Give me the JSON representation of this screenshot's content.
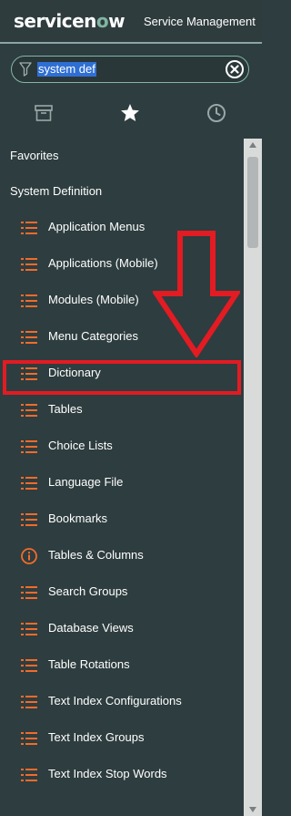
{
  "header": {
    "logo_prefix": "servicen",
    "logo_o": "o",
    "logo_suffix": "w",
    "subtitle": "Service Management"
  },
  "search": {
    "value": "system def",
    "filter_icon": "filter-icon",
    "clear_icon": "clear-circle-x-icon"
  },
  "tabs": [
    {
      "icon": "archive-box-icon",
      "name": "All applications"
    },
    {
      "icon": "star-icon",
      "name": "Favorites"
    },
    {
      "icon": "clock-icon",
      "name": "History"
    }
  ],
  "sections": [
    {
      "label": "Favorites"
    },
    {
      "label": "System Definition"
    }
  ],
  "items": [
    {
      "label": "Application Menus",
      "icon": "list-icon"
    },
    {
      "label": "Applications (Mobile)",
      "icon": "list-icon"
    },
    {
      "label": "Modules (Mobile)",
      "icon": "list-icon"
    },
    {
      "label": "Menu Categories",
      "icon": "list-icon"
    },
    {
      "label": "Dictionary",
      "icon": "list-icon"
    },
    {
      "label": "Tables",
      "icon": "list-icon"
    },
    {
      "label": "Choice Lists",
      "icon": "list-icon"
    },
    {
      "label": "Language File",
      "icon": "list-icon"
    },
    {
      "label": "Bookmarks",
      "icon": "list-icon"
    },
    {
      "label": "Tables & Columns",
      "icon": "info-circle-icon"
    },
    {
      "label": "Search Groups",
      "icon": "list-icon"
    },
    {
      "label": "Database Views",
      "icon": "list-icon"
    },
    {
      "label": "Table Rotations",
      "icon": "list-icon"
    },
    {
      "label": "Text Index Configurations",
      "icon": "list-icon"
    },
    {
      "label": "Text Index Groups",
      "icon": "list-icon"
    },
    {
      "label": "Text Index Stop Words",
      "icon": "list-icon"
    }
  ],
  "colors": {
    "accent_orange": "#f26b2a",
    "annotation_red": "#e31b23",
    "brand_green": "#81b5a1",
    "panel_bg": "#2e3d3f"
  }
}
